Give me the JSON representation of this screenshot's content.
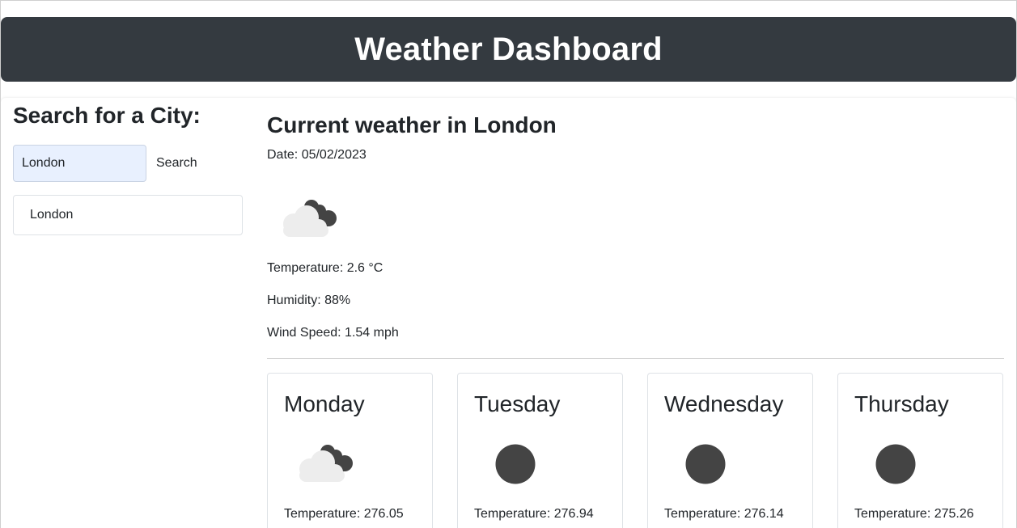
{
  "header": {
    "title": "Weather Dashboard"
  },
  "sidebar": {
    "title": "Search for a City:",
    "search_value": "London",
    "search_button": "Search",
    "history": [
      "London"
    ]
  },
  "current": {
    "title": "Current weather in London",
    "date": "Date: 05/02/2023",
    "icon": "cloudy-night-icon",
    "temperature": "Temperature: 2.6 °C",
    "humidity": "Humidity: 88%",
    "wind": "Wind Speed: 1.54 mph"
  },
  "forecast": [
    {
      "day": "Monday",
      "icon": "cloudy-night-icon",
      "temperature": "Temperature: 276.05"
    },
    {
      "day": "Tuesday",
      "icon": "moon-icon",
      "temperature": "Temperature: 276.94"
    },
    {
      "day": "Wednesday",
      "icon": "moon-icon",
      "temperature": "Temperature: 276.14"
    },
    {
      "day": "Thursday",
      "icon": "moon-icon",
      "temperature": "Temperature: 275.26"
    }
  ],
  "colors": {
    "header_bg": "#343a40",
    "input_bg": "#e8f0fe",
    "icon_dark": "#444444",
    "cloud_light": "#ededed"
  }
}
